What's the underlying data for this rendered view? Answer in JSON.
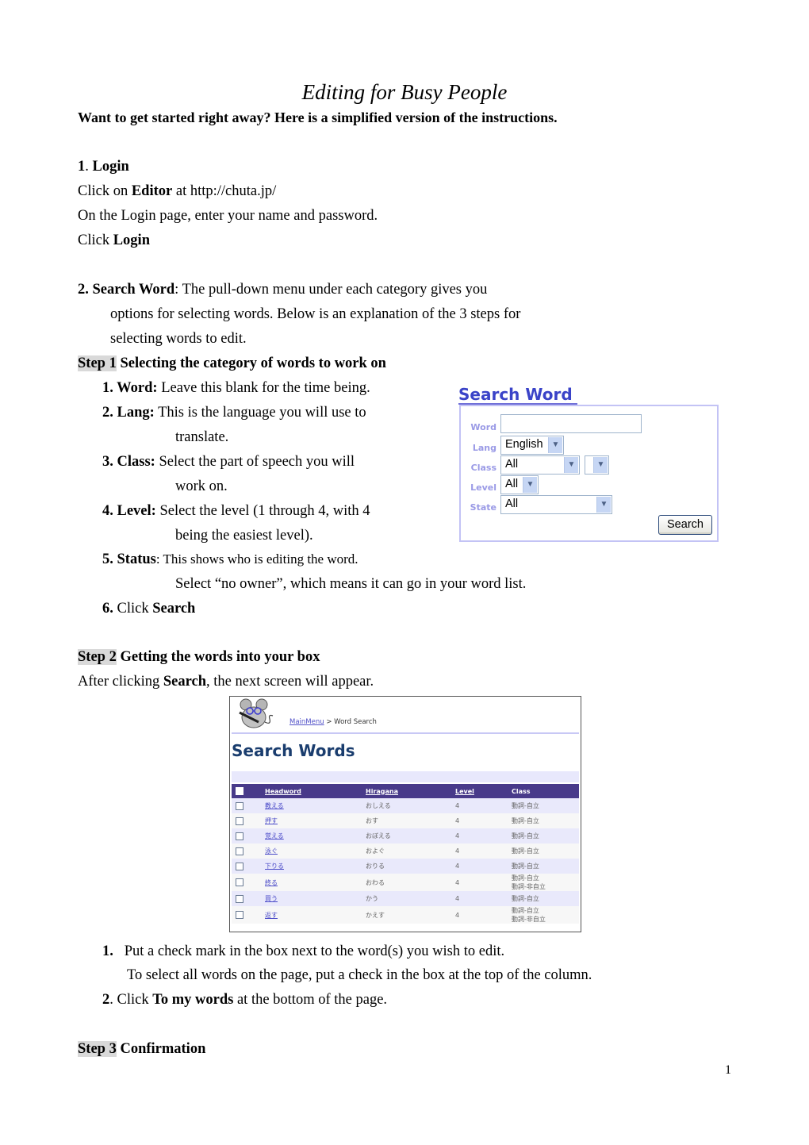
{
  "document": {
    "title": "Editing for Busy People",
    "subtitle": "Want to get started right away? Here is a simplified version of the instructions.",
    "page_number": "1"
  },
  "section1": {
    "number": "1",
    "heading": "Login",
    "line1_pre": "Click on ",
    "line1_bold": "Editor",
    "line1_post": " at http://chuta.jp/",
    "line2": "On the Login page, enter your name and password.",
    "line3_pre": "Click ",
    "line3_bold": "Login"
  },
  "section2": {
    "heading": "2. Search Word",
    "intro_line1": ":  The pull-down menu under each category gives you",
    "intro_line2": "options for selecting words. Below is an explanation of the 3 steps for",
    "intro_line3": "selecting words to edit."
  },
  "step1": {
    "label": "Step 1",
    "heading": " Selecting the category of words to work on",
    "items": [
      {
        "num": "1. Word:",
        "text": " Leave this blank for the time being.",
        "cont": ""
      },
      {
        "num": "2. Lang:",
        "text": " This is the language you will use to",
        "cont": "translate."
      },
      {
        "num": "3. Class:",
        "text": " Select the part of speech you will",
        "cont": "work on."
      },
      {
        "num": "4. Level:",
        "text": " Select the level (1 through 4, with 4",
        "cont": "being the easiest level)."
      },
      {
        "num": "5. Status",
        "text": ": This shows who is editing the word.",
        "cont": "Select “no owner”, which means it can go in your word list."
      },
      {
        "num": "6.",
        "text": " Click ",
        "bold_tail": "Search"
      }
    ]
  },
  "search_widget": {
    "title": "Search Word",
    "labels": {
      "word": "Word",
      "lang": "Lang",
      "class": "Class",
      "level": "Level",
      "state": "State"
    },
    "word_value": "",
    "lang_value": "English",
    "class_value": "All",
    "subclass_value": "",
    "level_value": "All",
    "state_value": "All",
    "button": "Search",
    "colors": {
      "title": "#3a43c8",
      "label": "#9a9ae6",
      "border": "#c3c3f5"
    }
  },
  "step2": {
    "label": "Step 2",
    "heading": " Getting the words into your box",
    "line_pre": "After clicking ",
    "line_bold": "Search",
    "line_post": ", the next screen will appear.",
    "items": [
      {
        "num": "1.",
        "text": "Put a check mark in the box next to the word(s) you wish to edit.",
        "cont": "To select all words on the page, put a check in the box at the top of the column."
      },
      {
        "num": "2",
        "text_pre": ". Click ",
        "bold": "To my words",
        "text_post": " at the bottom of the page."
      }
    ]
  },
  "screenshot": {
    "breadcrumb_link": "MainMenu",
    "breadcrumb_sep": " > ",
    "breadcrumb_current": "Word Search",
    "heading": "Search Words",
    "columns": [
      "Headword",
      "Hiragana",
      "Level",
      "Class"
    ],
    "rows": [
      {
        "headword": "教える",
        "hiragana": "おしえる",
        "level": "4",
        "class": [
          "動詞-自立"
        ]
      },
      {
        "headword": "押す",
        "hiragana": "おす",
        "level": "4",
        "class": [
          "動詞-自立"
        ]
      },
      {
        "headword": "覚える",
        "hiragana": "おぼえる",
        "level": "4",
        "class": [
          "動詞-自立"
        ]
      },
      {
        "headword": "泳ぐ",
        "hiragana": "およぐ",
        "level": "4",
        "class": [
          "動詞-自立"
        ]
      },
      {
        "headword": "下りる",
        "hiragana": "おりる",
        "level": "4",
        "class": [
          "動詞-自立"
        ]
      },
      {
        "headword": "終る",
        "hiragana": "おわる",
        "level": "4",
        "class": [
          "動詞-自立",
          "動詞-非自立"
        ]
      },
      {
        "headword": "買う",
        "hiragana": "かう",
        "level": "4",
        "class": [
          "動詞-自立"
        ]
      },
      {
        "headword": "返す",
        "hiragana": "かえす",
        "level": "4",
        "class": [
          "動詞-自立",
          "動詞-非自立"
        ]
      }
    ],
    "colors": {
      "header_bg": "#483a8a",
      "odd_row": "#e9e9fb",
      "even_row": "#f7f7f7",
      "heading": "#1a3d6e"
    }
  },
  "step3": {
    "label": "Step 3",
    "heading": " Confirmation"
  }
}
